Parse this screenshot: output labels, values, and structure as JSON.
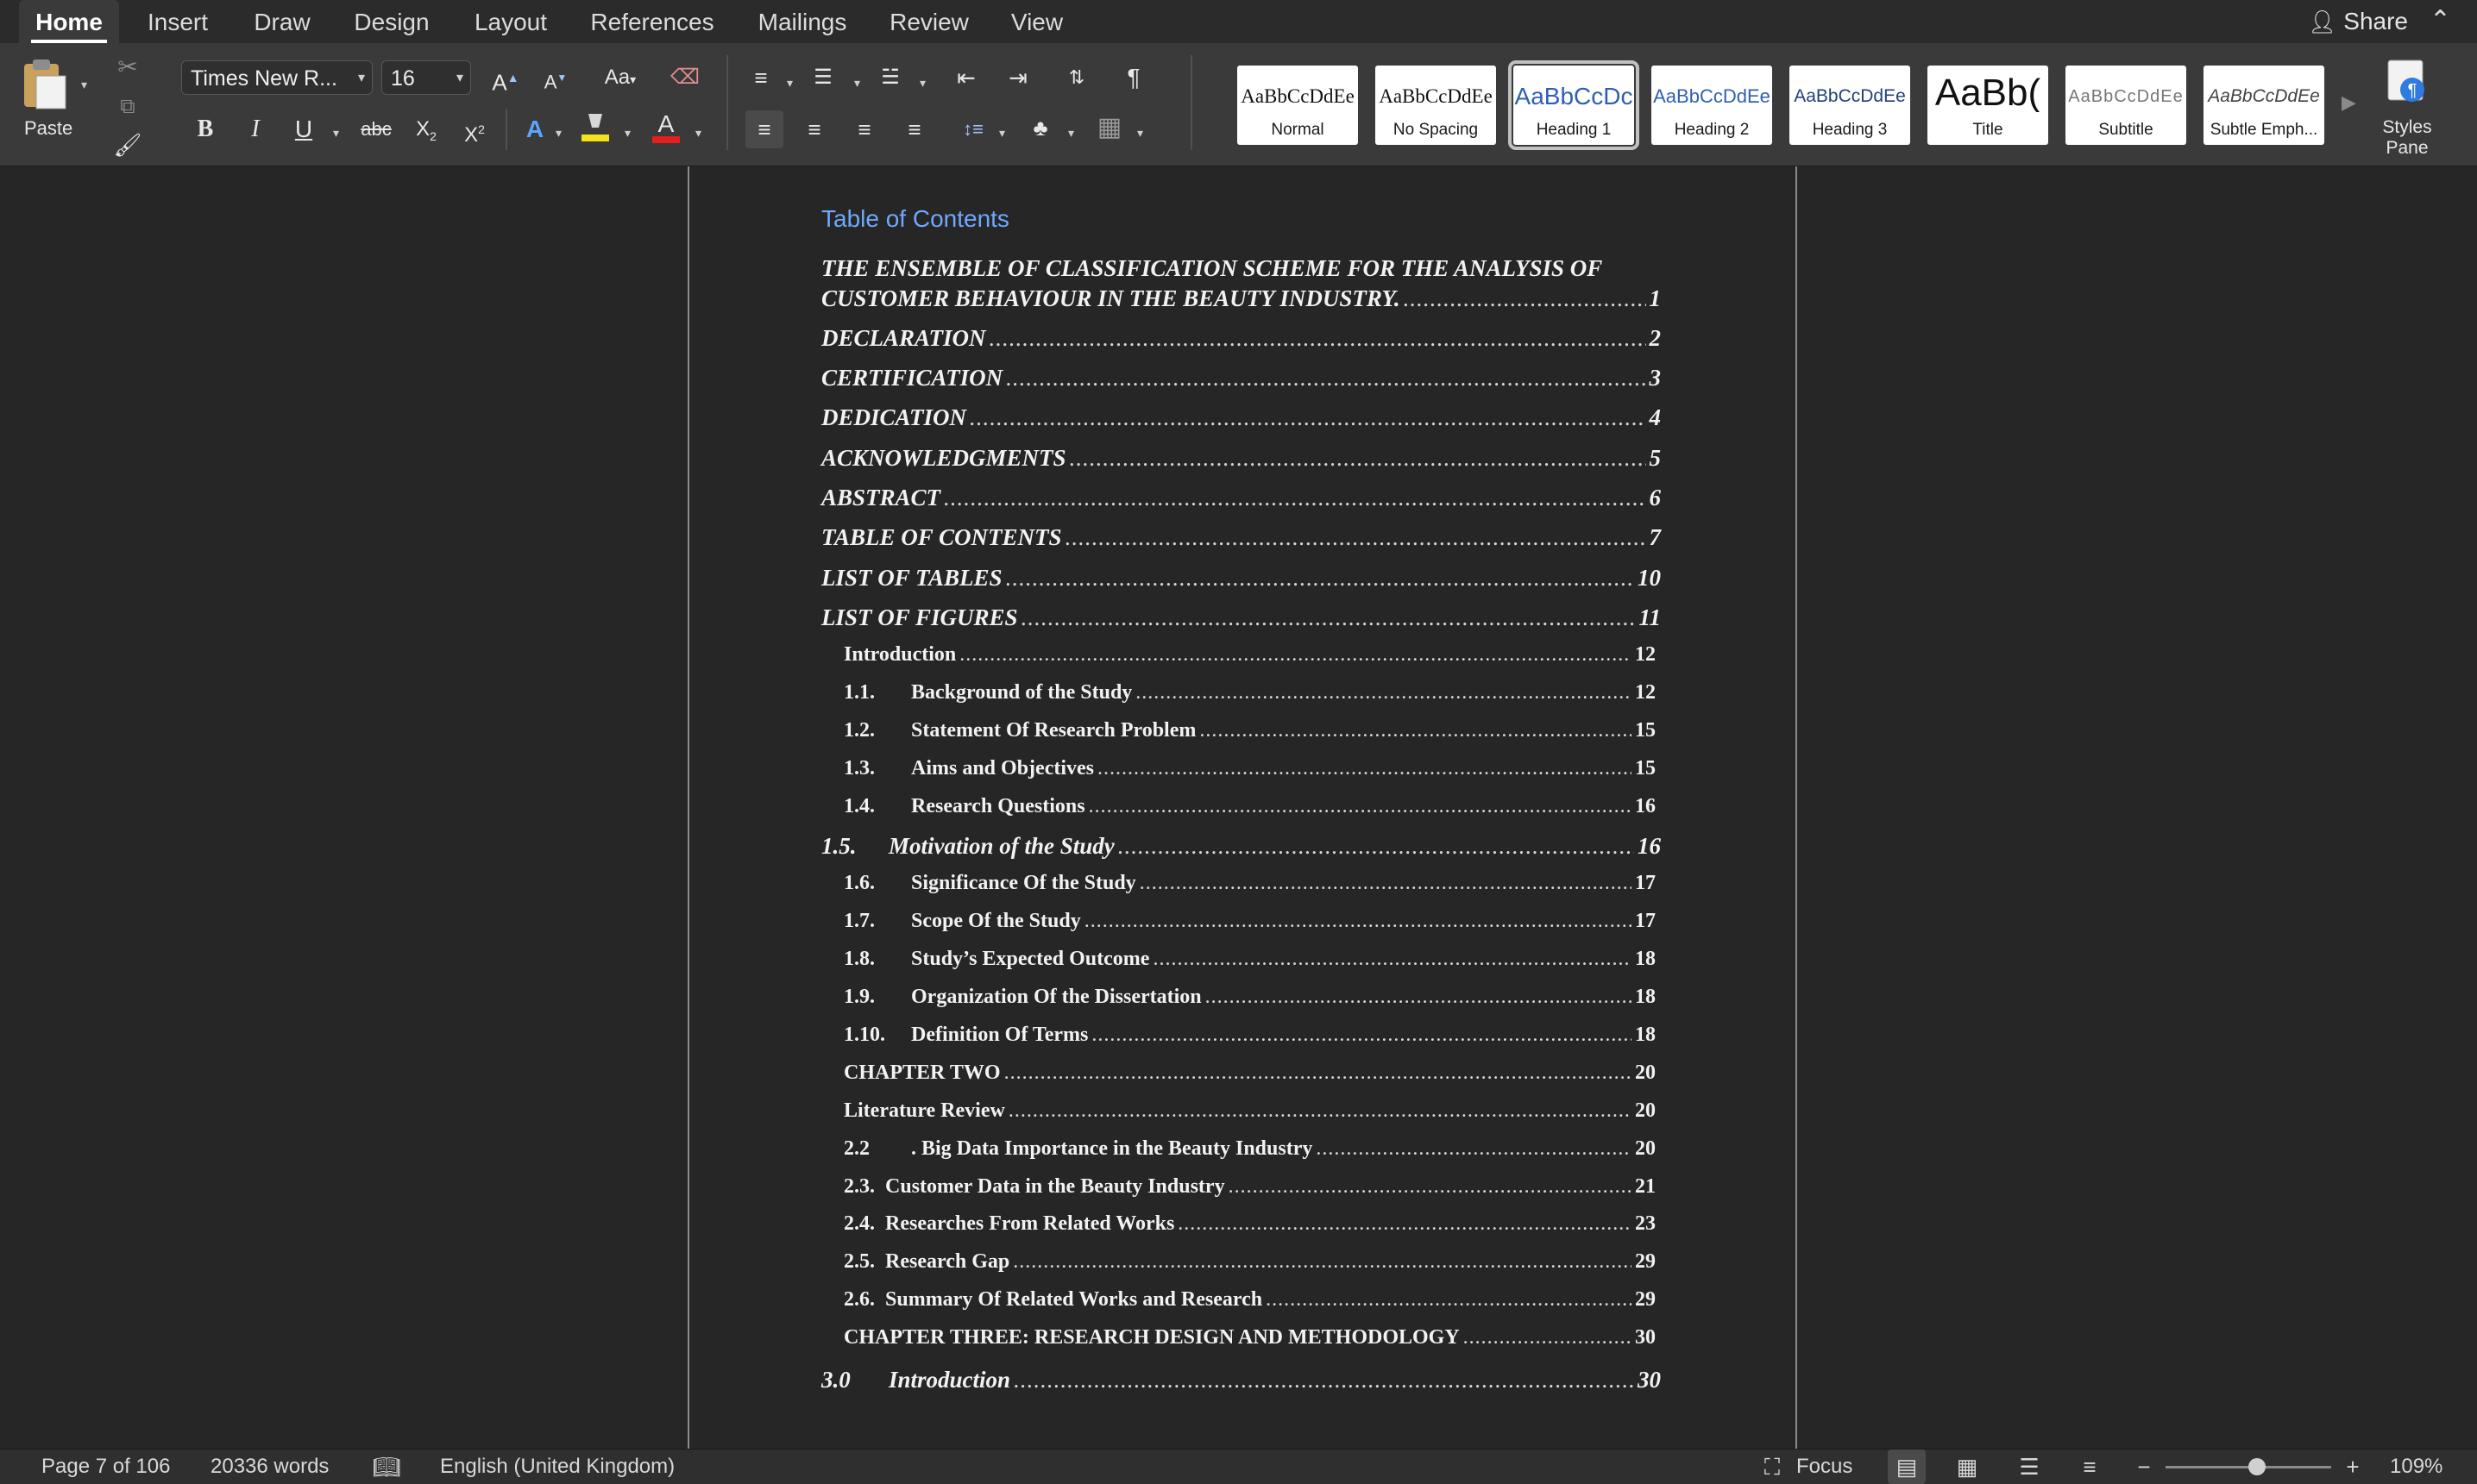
{
  "tabs": [
    {
      "label": "Home",
      "active": true
    },
    {
      "label": "Insert"
    },
    {
      "label": "Draw"
    },
    {
      "label": "Design"
    },
    {
      "label": "Layout"
    },
    {
      "label": "References"
    },
    {
      "label": "Mailings"
    },
    {
      "label": "Review"
    },
    {
      "label": "View"
    }
  ],
  "share_label": "Share",
  "ribbon": {
    "paste_label": "Paste",
    "font_name": "Times New R...",
    "font_size": "16",
    "bold": "B",
    "italic": "I",
    "underline": "U",
    "strikethrough": "abc",
    "subscript": "X",
    "subscript_mark": "2",
    "superscript": "X",
    "superscript_mark": "2",
    "font_color_letter": "A",
    "highlight_color": "#f5e21b",
    "font_color": "#e81d1d",
    "styles_pane_label_1": "Styles",
    "styles_pane_label_2": "Pane"
  },
  "styles": [
    {
      "sample": "AaBbCcDdEe",
      "label": "Normal"
    },
    {
      "sample": "AaBbCcDdEe",
      "label": "No Spacing"
    },
    {
      "sample": "AaBbCcDc",
      "label": "Heading 1",
      "selected": true
    },
    {
      "sample": "AaBbCcDdEe",
      "label": "Heading 2"
    },
    {
      "sample": "AaBbCcDdEe",
      "label": "Heading 3"
    },
    {
      "sample": "AaBb(",
      "label": "Title"
    },
    {
      "sample": "AaBbCcDdEe",
      "label": "Subtitle"
    },
    {
      "sample": "AaBbCcDdEe",
      "label": "Subtle Emph..."
    }
  ],
  "document": {
    "toc_heading": "Table of Contents",
    "first_entry_line1": "THE ENSEMBLE OF CLASSIFICATION SCHEME FOR THE ANALYSIS OF",
    "entries": [
      {
        "num": "",
        "text": "CUSTOMER BEHAVIOUR IN THE BEAUTY INDUSTRY.",
        "page": "1"
      },
      {
        "num": "",
        "text": "DECLARATION",
        "page": "2"
      },
      {
        "num": "",
        "text": "CERTIFICATION",
        "page": "3"
      },
      {
        "num": "",
        "text": "DEDICATION",
        "page": "4"
      },
      {
        "num": "",
        "text": "ACKNOWLEDGMENTS",
        "page": "5"
      },
      {
        "num": "",
        "text": "ABSTRACT",
        "page": "6"
      },
      {
        "num": "",
        "text": "TABLE OF CONTENTS",
        "page": "7"
      },
      {
        "num": "",
        "text": "LIST OF TABLES",
        "page": "10"
      },
      {
        "num": "",
        "text": "LIST OF FIGURES",
        "page": "11"
      },
      {
        "num": "",
        "text": "Introduction",
        "page": "12"
      },
      {
        "num": "1.1.",
        "text": "Background of the Study",
        "page": "12"
      },
      {
        "num": "1.2.",
        "text": "Statement Of Research Problem",
        "page": "15"
      },
      {
        "num": "1.3.",
        "text": "Aims and Objectives",
        "page": "15"
      },
      {
        "num": "1.4.",
        "text": "Research Questions",
        "page": "16"
      },
      {
        "num": "1.5.",
        "text": "Motivation of the Study",
        "page": "16"
      },
      {
        "num": "1.6.",
        "text": "Significance Of the Study",
        "page": "17"
      },
      {
        "num": "1.7.",
        "text": "Scope Of the Study",
        "page": "17"
      },
      {
        "num": "1.8.",
        "text": "Study’s Expected Outcome",
        "page": "18"
      },
      {
        "num": "1.9.",
        "text": "Organization Of the Dissertation",
        "page": "18"
      },
      {
        "num": "1.10.",
        "text": "Definition Of Terms",
        "page": "18"
      },
      {
        "num": "",
        "text": "CHAPTER TWO",
        "page": "20"
      },
      {
        "num": "",
        "text": "Literature Review",
        "page": "20"
      },
      {
        "num": "2.2",
        "text": ". Big Data Importance in the Beauty Industry",
        "page": "20"
      },
      {
        "num": "2.3.",
        "text": "Customer Data in the Beauty Industry",
        "page": "21"
      },
      {
        "num": "2.4.",
        "text": "Researches From Related Works",
        "page": "23"
      },
      {
        "num": "2.5.",
        "text": "Research Gap",
        "page": "29"
      },
      {
        "num": "2.6.",
        "text": "Summary Of Related Works and Research",
        "page": "29"
      },
      {
        "num": "",
        "text": "CHAPTER THREE: RESEARCH DESIGN AND METHODOLOGY",
        "page": "30"
      },
      {
        "num": "3.0",
        "text": "Introduction",
        "page": "30"
      }
    ]
  },
  "status": {
    "page": "Page 7 of 106",
    "words": "20336 words",
    "language": "English (United Kingdom)",
    "focus": "Focus",
    "zoom": "109%",
    "zoom_minus": "−",
    "zoom_plus": "+",
    "zoom_fraction": 0.55
  }
}
